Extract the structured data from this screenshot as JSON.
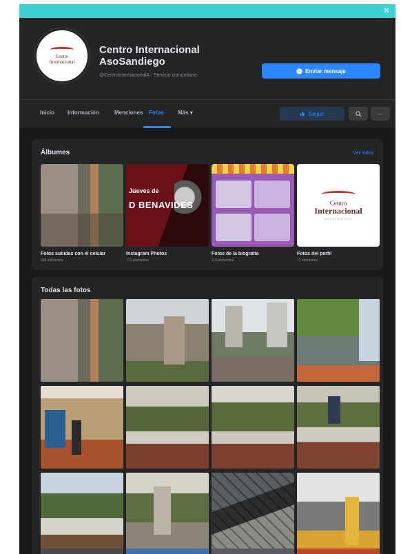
{
  "page": {
    "name_line1": "Centro Internacional",
    "name_line2": "AsoSandiego",
    "handle": "@CentroInternacionalA · Servicio comunitario",
    "send_message_label": "Enviar mensaje",
    "follow_label": "Seguir"
  },
  "nav": {
    "tabs": [
      "Inicio",
      "Información",
      "Menciones",
      "Fotos",
      "Más ▾"
    ],
    "active_tab": "Fotos"
  },
  "albums": {
    "title": "Álbumes",
    "see_all": "Ver todos",
    "items": [
      {
        "name": "Fotos subidas con el celular",
        "count": "238 elementos"
      },
      {
        "name": "Instagram Photos",
        "count": "171 elementos"
      },
      {
        "name": "Fotos de la biografía",
        "count": "118 elementos"
      },
      {
        "name": "Fotos del perfil",
        "count": "12 elementos"
      }
    ],
    "poster_small": "Jueves de",
    "poster_title": "D BENAVIDES",
    "logo": {
      "line1": "Centro",
      "line2": "Internacional",
      "line3": "ASOSANDIEGO"
    }
  },
  "all_photos": {
    "title": "Todas las fotos"
  },
  "icons": {
    "close": "close-icon",
    "send": "messenger-icon",
    "follow": "follow-icon",
    "search": "search-icon",
    "more": "more-icon"
  },
  "colors": {
    "accent": "#2d88ff",
    "topbar": "#3fd0d4",
    "background": "#18191a",
    "card": "#242526"
  }
}
